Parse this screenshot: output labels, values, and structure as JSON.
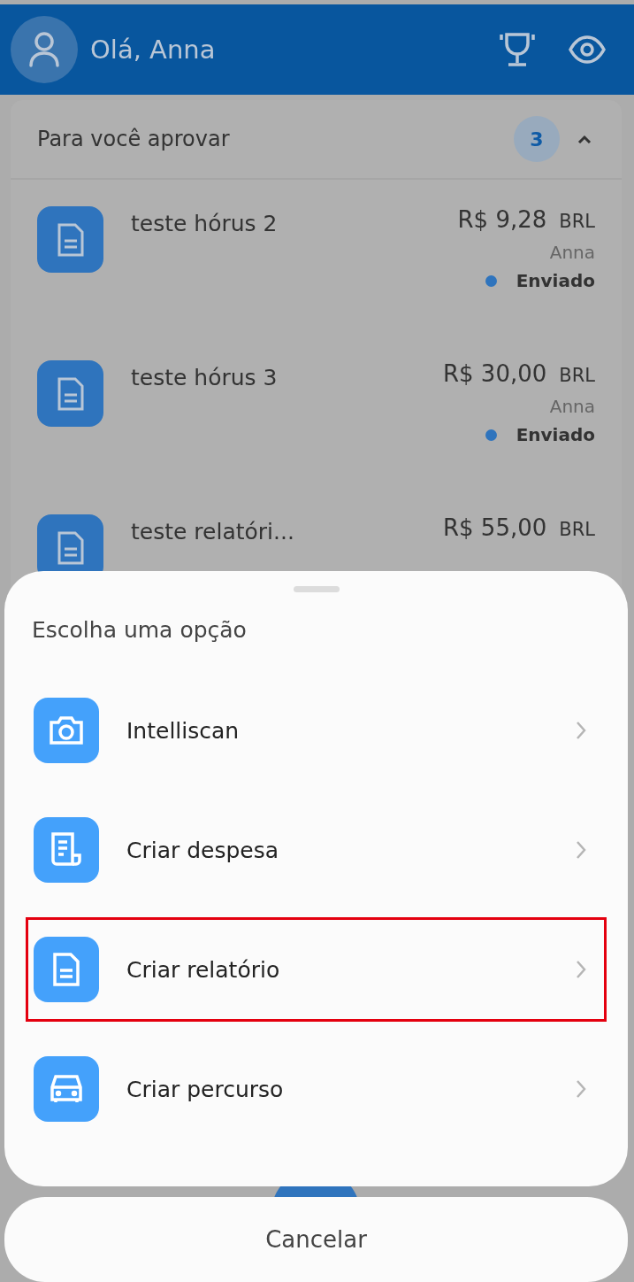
{
  "header": {
    "greeting": "Olá, Anna"
  },
  "approvals": {
    "title": "Para você aprovar",
    "count": "3",
    "expanded": true,
    "items": [
      {
        "title": "teste hórus 2",
        "amount": "R$ 9,28",
        "currency": "BRL",
        "submitter": "Anna",
        "status": "Enviado"
      },
      {
        "title": "teste hórus 3",
        "amount": "R$ 30,00",
        "currency": "BRL",
        "submitter": "Anna",
        "status": "Enviado"
      },
      {
        "title": "teste relatóri...",
        "amount": "R$ 55,00",
        "currency": "BRL"
      }
    ]
  },
  "sheet": {
    "title": "Escolha uma opção",
    "options": [
      {
        "kind": "camera",
        "label": "Intelliscan",
        "highlighted": false
      },
      {
        "kind": "receipt",
        "label": "Criar despesa",
        "highlighted": false
      },
      {
        "kind": "document",
        "label": "Criar relatório",
        "highlighted": true
      },
      {
        "kind": "car",
        "label": "Criar percurso",
        "highlighted": false
      }
    ],
    "cancel": "Cancelar"
  }
}
